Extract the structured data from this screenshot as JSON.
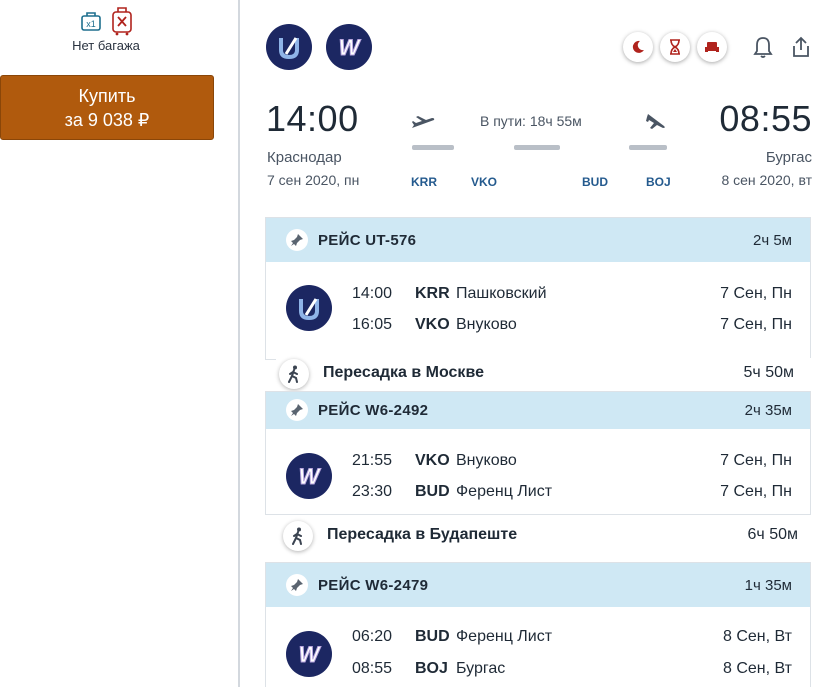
{
  "sidebar": {
    "baggage_badge": "x1",
    "baggage_label": "Нет багажа",
    "buy_line1": "Купить",
    "buy_line2": "за 9 038 ₽"
  },
  "header": {
    "airlines": [
      {
        "letter": "U",
        "icon": "utair-logo"
      },
      {
        "letter": "W",
        "icon": "wizzair-logo"
      }
    ],
    "icons": [
      "night-flight-icon",
      "long-layover-icon",
      "seat-icon",
      "bell-icon",
      "share-icon"
    ]
  },
  "route": {
    "departure": {
      "time": "14:00",
      "city": "Краснодар",
      "date": "7 сен 2020, пн",
      "code": "KRR"
    },
    "arrival": {
      "time": "08:55",
      "city": "Бургас",
      "date": "8 сен 2020, вт",
      "code": "BOJ"
    },
    "duration": "В пути: 18ч 55м",
    "stops": [
      "VKO",
      "BUD"
    ]
  },
  "segments": [
    {
      "flight": "РЕЙС UT-576",
      "duration": "2ч 5м",
      "logo_letter": "U",
      "rows": [
        {
          "time": "14:00",
          "code": "KRR",
          "name": "Пашковский",
          "date": "7 Сен, Пн"
        },
        {
          "time": "16:05",
          "code": "VKO",
          "name": "Внуково",
          "date": "7 Сен, Пн"
        }
      ]
    },
    {
      "flight": "РЕЙС W6-2492",
      "duration": "2ч 35м",
      "logo_letter": "W",
      "rows": [
        {
          "time": "21:55",
          "code": "VKO",
          "name": "Внуково",
          "date": "7 Сен, Пн"
        },
        {
          "time": "23:30",
          "code": "BUD",
          "name": "Ференц Лист",
          "date": "7 Сен, Пн"
        }
      ]
    },
    {
      "flight": "РЕЙС W6-2479",
      "duration": "1ч 35м",
      "logo_letter": "W",
      "rows": [
        {
          "time": "06:20",
          "code": "BUD",
          "name": "Ференц Лист",
          "date": "8 Сен, Вт"
        },
        {
          "time": "08:55",
          "code": "BOJ",
          "name": "Бургас",
          "date": "8 Сен, Вт"
        }
      ]
    }
  ],
  "transfers": [
    {
      "label": "Пересадка в Москве",
      "duration": "5ч 50м"
    },
    {
      "label": "Пересадка в Будапеште",
      "duration": "6ч 50м"
    }
  ],
  "colors": {
    "buy_button": "#b05a0d",
    "segment_header": "#cfe8f4",
    "airline_logo": "#1c2762",
    "code_blue": "#245a8e",
    "accent_red": "#b0231d"
  }
}
